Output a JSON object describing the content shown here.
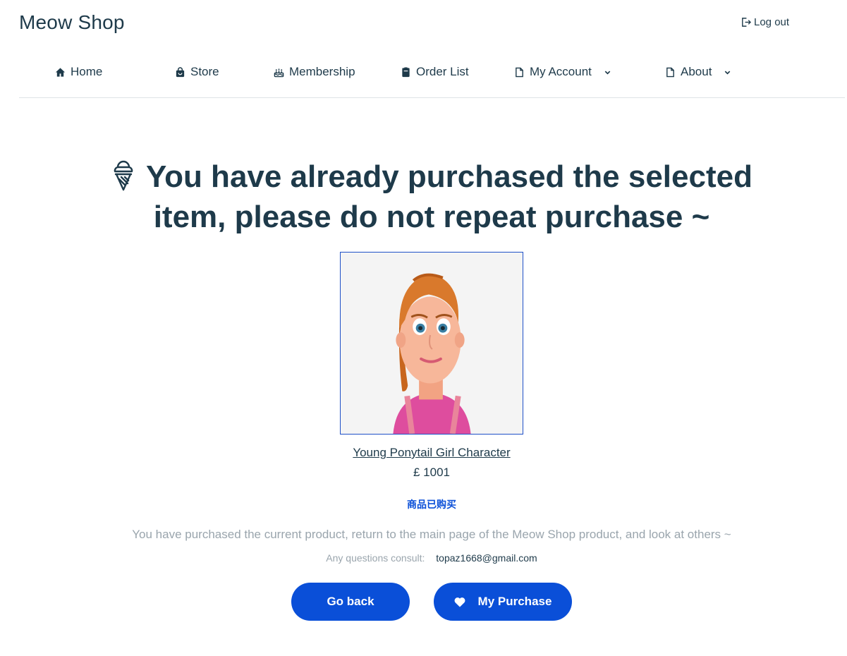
{
  "header": {
    "brand": "Meow Shop",
    "logout_label": "Log out"
  },
  "nav": {
    "items": [
      {
        "label": "Home",
        "icon": "home-icon"
      },
      {
        "label": "Store",
        "icon": "shopping-bag-icon"
      },
      {
        "label": "Membership",
        "icon": "cake-icon"
      },
      {
        "label": "Order List",
        "icon": "clipboard-icon"
      },
      {
        "label": "My Account",
        "icon": "document-icon",
        "dropdown": true
      },
      {
        "label": "About",
        "icon": "document-icon",
        "dropdown": true
      }
    ]
  },
  "main": {
    "headline": "You have already purchased the selected item, please do not repeat purchase ~",
    "product": {
      "name": "Young Ponytail Girl Character",
      "price": "£ 1001"
    },
    "status": "商品已购买",
    "message": "You have purchased the current product, return to the main page of the Meow Shop product, and look at others ~",
    "contact": {
      "label": "Any questions consult:",
      "email": "topaz1668@gmail.com"
    },
    "buttons": {
      "back": "Go back",
      "purchase": "My Purchase"
    }
  },
  "colors": {
    "primary_text": "#1e3a4a",
    "accent": "#0a4fd8",
    "muted": "#9aa5ad"
  }
}
